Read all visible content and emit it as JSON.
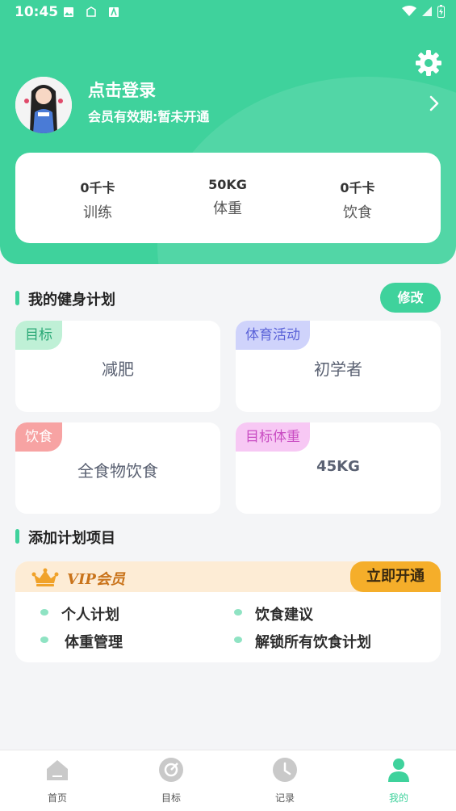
{
  "status_bar": {
    "time": "10:45"
  },
  "header": {
    "login_title": "点击登录",
    "member_status": "会员有效期:暂未开通"
  },
  "stats": [
    {
      "value": "0千卡",
      "label": "训练"
    },
    {
      "value": "50KG",
      "label": "体重"
    },
    {
      "value": "0千卡",
      "label": "饮食"
    }
  ],
  "plan": {
    "section_title": "我的健身计划",
    "edit_label": "修改",
    "cards": [
      {
        "tag": "目标",
        "value": "减肥",
        "tag_bg": "#bff0d6",
        "tag_color": "#2aa876"
      },
      {
        "tag": "体育活动",
        "value": "初学者",
        "tag_bg": "#cfd3fb",
        "tag_color": "#5b63d8"
      },
      {
        "tag": "饮食",
        "value": "全食物饮食",
        "tag_bg": "#f7a3a3",
        "tag_color": "#ffffff"
      },
      {
        "tag": "目标体重",
        "value": "45KG",
        "tag_bg": "#f7c8f4",
        "tag_color": "#c94cc2"
      }
    ]
  },
  "add_section": {
    "title": "添加计划项目"
  },
  "vip": {
    "badge_text": "VIP会员",
    "open_label": "立即开通",
    "perks": [
      "个人计划",
      "饮食建议",
      "体重管理",
      "解锁所有饮食计划"
    ]
  },
  "nav": [
    {
      "label": "首页",
      "icon": "home-icon",
      "active": false
    },
    {
      "label": "目标",
      "icon": "target-icon",
      "active": false
    },
    {
      "label": "记录",
      "icon": "clock-icon",
      "active": false
    },
    {
      "label": "我的",
      "icon": "person-icon",
      "active": true
    }
  ],
  "colors": {
    "accent": "#3fd29c",
    "vip_gold": "#f5ae2a"
  }
}
